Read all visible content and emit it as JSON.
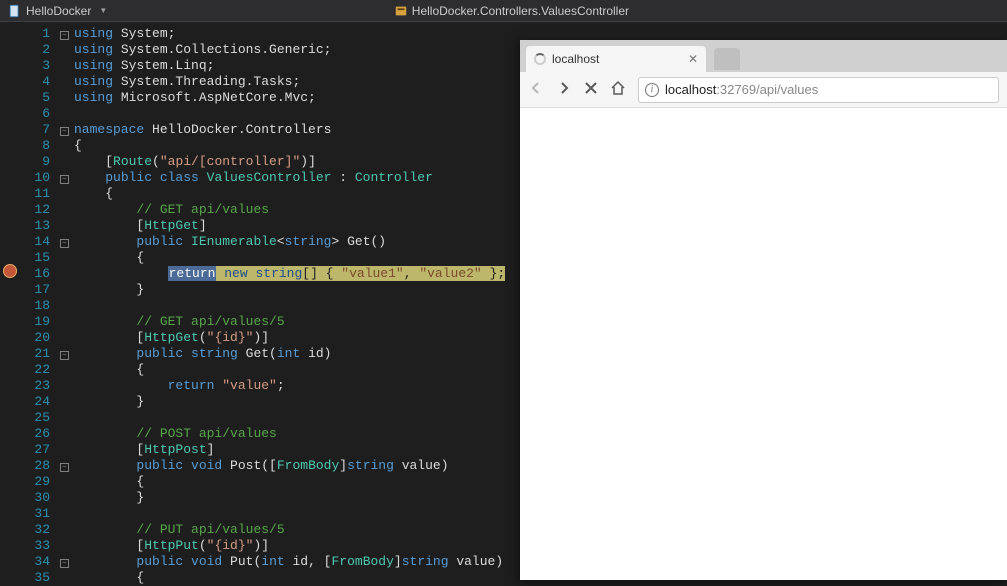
{
  "navbar": {
    "left": "HelloDocker",
    "right": "HelloDocker.Controllers.ValuesController"
  },
  "code": {
    "lines": [
      {
        "n": 1,
        "fold": "-",
        "t": [
          [
            "kw",
            "using "
          ],
          [
            "",
            "System;"
          ]
        ]
      },
      {
        "n": 2,
        "fold": "",
        "t": [
          [
            "kw",
            "using "
          ],
          [
            "",
            "System.Collections.Generic;"
          ]
        ]
      },
      {
        "n": 3,
        "fold": "",
        "t": [
          [
            "kw",
            "using "
          ],
          [
            "",
            "System.Linq;"
          ]
        ]
      },
      {
        "n": 4,
        "fold": "",
        "t": [
          [
            "kw",
            "using "
          ],
          [
            "",
            "System.Threading.Tasks;"
          ]
        ]
      },
      {
        "n": 5,
        "fold": "",
        "t": [
          [
            "kw",
            "using "
          ],
          [
            "",
            "Microsoft.AspNetCore.Mvc;"
          ]
        ]
      },
      {
        "n": 6,
        "fold": "",
        "t": [
          [
            "",
            ""
          ]
        ]
      },
      {
        "n": 7,
        "fold": "-",
        "t": [
          [
            "kw",
            "namespace "
          ],
          [
            "",
            "HelloDocker.Controllers"
          ]
        ]
      },
      {
        "n": 8,
        "fold": "",
        "t": [
          [
            "",
            "{"
          ]
        ]
      },
      {
        "n": 9,
        "fold": "",
        "t": [
          [
            "",
            "    ["
          ],
          [
            "type",
            "Route"
          ],
          [
            "",
            "("
          ],
          [
            "str",
            "\"api/[controller]\""
          ],
          [
            "",
            ")]"
          ]
        ]
      },
      {
        "n": 10,
        "fold": "-",
        "t": [
          [
            "",
            "    "
          ],
          [
            "kw",
            "public class "
          ],
          [
            "type",
            "ValuesController"
          ],
          [
            "",
            " : "
          ],
          [
            "type",
            "Controller"
          ]
        ]
      },
      {
        "n": 11,
        "fold": "",
        "t": [
          [
            "",
            "    {"
          ]
        ]
      },
      {
        "n": 12,
        "fold": "",
        "t": [
          [
            "",
            "        "
          ],
          [
            "comment",
            "// GET api/values"
          ]
        ]
      },
      {
        "n": 13,
        "fold": "",
        "t": [
          [
            "",
            "        ["
          ],
          [
            "type",
            "HttpGet"
          ],
          [
            "",
            "]"
          ]
        ]
      },
      {
        "n": 14,
        "fold": "-",
        "t": [
          [
            "",
            "        "
          ],
          [
            "kw",
            "public "
          ],
          [
            "type",
            "IEnumerable"
          ],
          [
            "",
            "<"
          ],
          [
            "kw",
            "string"
          ],
          [
            "",
            "> Get()"
          ]
        ]
      },
      {
        "n": 15,
        "fold": "",
        "t": [
          [
            "",
            "        {"
          ]
        ]
      },
      {
        "n": 16,
        "fold": "",
        "bp": true,
        "hl": true,
        "t": [
          [
            "",
            "            "
          ],
          [
            "ret",
            "return"
          ],
          [
            "",
            " "
          ],
          [
            "kw2",
            "new"
          ],
          [
            "",
            " "
          ],
          [
            "kw2",
            "string"
          ],
          [
            "",
            "[] { "
          ],
          [
            "str2",
            "\"value1\""
          ],
          [
            "",
            ", "
          ],
          [
            "str2",
            "\"value2\""
          ],
          [
            "",
            " };"
          ]
        ]
      },
      {
        "n": 17,
        "fold": "",
        "t": [
          [
            "",
            "        }"
          ]
        ]
      },
      {
        "n": 18,
        "fold": "",
        "t": [
          [
            "",
            ""
          ]
        ]
      },
      {
        "n": 19,
        "fold": "",
        "t": [
          [
            "",
            "        "
          ],
          [
            "comment",
            "// GET api/values/5"
          ]
        ]
      },
      {
        "n": 20,
        "fold": "",
        "t": [
          [
            "",
            "        ["
          ],
          [
            "type",
            "HttpGet"
          ],
          [
            "",
            "("
          ],
          [
            "str",
            "\"{id}\""
          ],
          [
            "",
            ")]"
          ]
        ]
      },
      {
        "n": 21,
        "fold": "-",
        "t": [
          [
            "",
            "        "
          ],
          [
            "kw",
            "public "
          ],
          [
            "kw",
            "string"
          ],
          [
            "",
            " Get("
          ],
          [
            "kw",
            "int"
          ],
          [
            "",
            " id)"
          ]
        ]
      },
      {
        "n": 22,
        "fold": "",
        "t": [
          [
            "",
            "        {"
          ]
        ]
      },
      {
        "n": 23,
        "fold": "",
        "t": [
          [
            "",
            "            "
          ],
          [
            "kw",
            "return "
          ],
          [
            "str",
            "\"value\""
          ],
          [
            "",
            ";"
          ]
        ]
      },
      {
        "n": 24,
        "fold": "",
        "t": [
          [
            "",
            "        }"
          ]
        ]
      },
      {
        "n": 25,
        "fold": "",
        "t": [
          [
            "",
            ""
          ]
        ]
      },
      {
        "n": 26,
        "fold": "",
        "t": [
          [
            "",
            "        "
          ],
          [
            "comment",
            "// POST api/values"
          ]
        ]
      },
      {
        "n": 27,
        "fold": "",
        "t": [
          [
            "",
            "        ["
          ],
          [
            "type",
            "HttpPost"
          ],
          [
            "",
            "]"
          ]
        ]
      },
      {
        "n": 28,
        "fold": "-",
        "t": [
          [
            "",
            "        "
          ],
          [
            "kw",
            "public "
          ],
          [
            "kw",
            "void"
          ],
          [
            "",
            " Post(["
          ],
          [
            "type",
            "FromBody"
          ],
          [
            "",
            "]"
          ],
          [
            "kw",
            "string"
          ],
          [
            "",
            " value)"
          ]
        ]
      },
      {
        "n": 29,
        "fold": "",
        "t": [
          [
            "",
            "        {"
          ]
        ]
      },
      {
        "n": 30,
        "fold": "",
        "t": [
          [
            "",
            "        }"
          ]
        ]
      },
      {
        "n": 31,
        "fold": "",
        "t": [
          [
            "",
            ""
          ]
        ]
      },
      {
        "n": 32,
        "fold": "",
        "t": [
          [
            "",
            "        "
          ],
          [
            "comment",
            "// PUT api/values/5"
          ]
        ]
      },
      {
        "n": 33,
        "fold": "",
        "t": [
          [
            "",
            "        ["
          ],
          [
            "type",
            "HttpPut"
          ],
          [
            "",
            "("
          ],
          [
            "str",
            "\"{id}\""
          ],
          [
            "",
            ")]"
          ]
        ]
      },
      {
        "n": 34,
        "fold": "-",
        "t": [
          [
            "",
            "        "
          ],
          [
            "kw",
            "public "
          ],
          [
            "kw",
            "void"
          ],
          [
            "",
            " Put("
          ],
          [
            "kw",
            "int"
          ],
          [
            "",
            " id, ["
          ],
          [
            "type",
            "FromBody"
          ],
          [
            "",
            "]"
          ],
          [
            "kw",
            "string"
          ],
          [
            "",
            " value)"
          ]
        ]
      },
      {
        "n": 35,
        "fold": "",
        "t": [
          [
            "",
            "        {"
          ]
        ]
      }
    ]
  },
  "browser": {
    "tab_title": "localhost",
    "url_host": "localhost",
    "url_rest": ":32769/api/values"
  }
}
